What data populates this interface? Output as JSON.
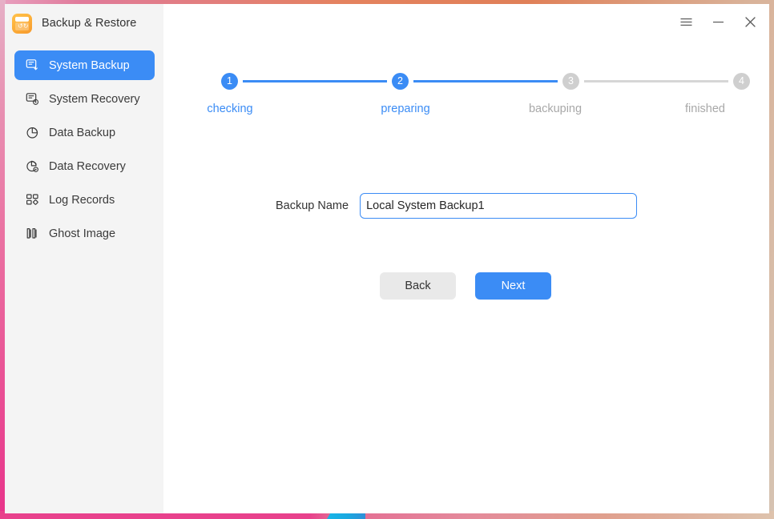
{
  "window": {
    "app_title": "Backup & Restore",
    "app_icon": "backup-restore-app-icon",
    "controls": {
      "menu": "☰",
      "minimize": "–",
      "close": "✕"
    }
  },
  "sidebar": {
    "items": [
      {
        "label": "System Backup",
        "icon": "monitor-download-icon",
        "active": true
      },
      {
        "label": "System Recovery",
        "icon": "monitor-restore-icon",
        "active": false
      },
      {
        "label": "Data Backup",
        "icon": "pie-chart-icon",
        "active": false
      },
      {
        "label": "Data Recovery",
        "icon": "pie-restore-icon",
        "active": false
      },
      {
        "label": "Log Records",
        "icon": "grid-squares-icon",
        "active": false
      },
      {
        "label": "Ghost Image",
        "icon": "dual-bars-icon",
        "active": false
      }
    ]
  },
  "stepper": {
    "steps": [
      {
        "number": "1",
        "label": "checking",
        "state": "active"
      },
      {
        "number": "2",
        "label": "preparing",
        "state": "active"
      },
      {
        "number": "3",
        "label": "backuping",
        "state": "idle"
      },
      {
        "number": "4",
        "label": "finished",
        "state": "idle"
      }
    ],
    "connectors": [
      "active",
      "active",
      "idle"
    ]
  },
  "form": {
    "label": "Backup Name",
    "value": "Local System Backup1",
    "placeholder": "Backup Name"
  },
  "buttons": {
    "back": "Back",
    "next": "Next"
  },
  "colors": {
    "accent_blue": "#3b8cf5",
    "idle_gray": "#cfcfcf",
    "sidebar_bg": "#f4f4f4",
    "app_icon_orange": "#fdb13a"
  }
}
